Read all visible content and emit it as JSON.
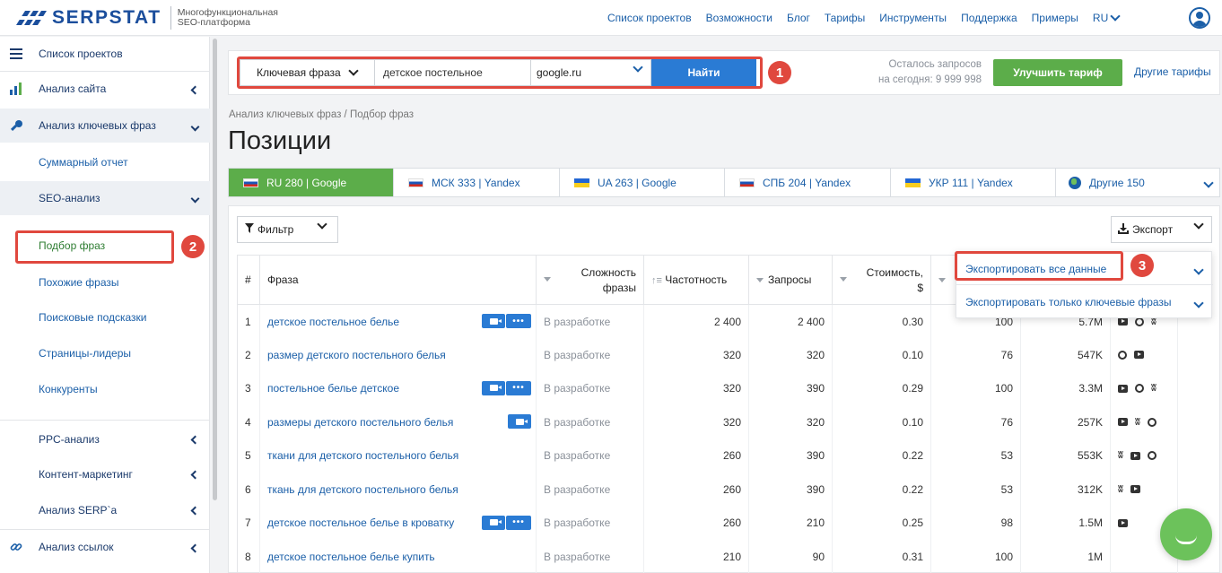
{
  "brand": {
    "name": "SERPSTAT",
    "tagline_line1": "Многофункциональная",
    "tagline_line2": "SEO-платформа"
  },
  "topnav": {
    "items": [
      "Список проектов",
      "Возможности",
      "Блог",
      "Тарифы",
      "Инструменты",
      "Поддержка",
      "Примеры"
    ],
    "language": "RU"
  },
  "sidebar": {
    "items": [
      {
        "label": "Список проектов",
        "icon": "menu-icon"
      },
      {
        "label": "Анализ сайта",
        "icon": "bar-chart-icon"
      },
      {
        "label": "Анализ ключевых фраз",
        "icon": "key-icon"
      },
      {
        "label": "Суммарный отчет"
      },
      {
        "label": "SEO-анализ"
      },
      {
        "label": "Подбор фраз"
      },
      {
        "label": "Похожие фразы"
      },
      {
        "label": "Поисковые подсказки"
      },
      {
        "label": "Страницы-лидеры"
      },
      {
        "label": "Конкуренты"
      },
      {
        "label": "PPC-анализ"
      },
      {
        "label": "Контент-маркетинг"
      },
      {
        "label": "Анализ SERP`а"
      },
      {
        "label": "Анализ ссылок",
        "icon": "link-icon"
      }
    ]
  },
  "search": {
    "type_label": "Ключевая фраза",
    "query": "детское постельное",
    "engine": "google.ru",
    "find_label": "Найти"
  },
  "account": {
    "remaining_line1": "Осталось запросов",
    "remaining_line2": "на сегодня: 9 999 998",
    "upgrade_label": "Улучшить тариф",
    "other_tariffs": "Другие тарифы"
  },
  "page": {
    "breadcrumb": "Анализ ключевых фраз / Подбор фраз",
    "title": "Позиции"
  },
  "tabs": [
    {
      "label": "RU 280 | Google",
      "flag": "ru",
      "active": true
    },
    {
      "label": "МСК 333 | Yandex",
      "flag": "ru"
    },
    {
      "label": "UA 263 | Google",
      "flag": "ua"
    },
    {
      "label": "СПБ 204 | Yandex",
      "flag": "ru"
    },
    {
      "label": "УКР 111 | Yandex",
      "flag": "ua"
    },
    {
      "label": "Другие 150",
      "flag": "globe"
    }
  ],
  "toolbar": {
    "filter_label": "Фильтр",
    "export_label": "Экспорт"
  },
  "export_menu": {
    "all_data": "Экспортировать все данные",
    "keywords_only": "Экспортировать только ключевые фразы"
  },
  "callouts": [
    "1",
    "2",
    "3"
  ],
  "table": {
    "headers": {
      "num": "#",
      "phrase": "Фраза",
      "difficulty_1": "Сложность",
      "difficulty_2": "фразы",
      "frequency": "Частотность",
      "queries": "Запросы",
      "cost_1": "Стоимость,",
      "cost_2": "$"
    },
    "rows": [
      {
        "n": "1",
        "phrase": "детское постельное белье",
        "difficulty": "В разработке",
        "freq": "2 400",
        "queries": "2 400",
        "cost": "0.30",
        "comp": "100",
        "results": "5.7M",
        "actions": "video-more",
        "social": [
          "youtube-icon",
          "pinterest-icon",
          "vk-icon"
        ]
      },
      {
        "n": "2",
        "phrase": "размер детского постельного белья",
        "difficulty": "В разработке",
        "freq": "320",
        "queries": "320",
        "cost": "0.10",
        "comp": "76",
        "results": "547K",
        "actions": "",
        "social": [
          "pinterest-icon",
          "youtube-icon"
        ]
      },
      {
        "n": "3",
        "phrase": "постельное белье детское",
        "difficulty": "В разработке",
        "freq": "320",
        "queries": "390",
        "cost": "0.29",
        "comp": "100",
        "results": "3.3M",
        "actions": "video-more",
        "social": [
          "youtube-icon",
          "pinterest-icon",
          "vk-icon"
        ]
      },
      {
        "n": "4",
        "phrase": "размеры детского постельного белья",
        "difficulty": "В разработке",
        "freq": "320",
        "queries": "320",
        "cost": "0.10",
        "comp": "76",
        "results": "257K",
        "actions": "video",
        "social": [
          "youtube-icon",
          "vk-icon",
          "pinterest-icon"
        ]
      },
      {
        "n": "5",
        "phrase": "ткани для детского постельного белья",
        "difficulty": "В разработке",
        "freq": "260",
        "queries": "390",
        "cost": "0.22",
        "comp": "53",
        "results": "553K",
        "actions": "",
        "social": [
          "vk-icon",
          "youtube-icon",
          "pinterest-icon"
        ]
      },
      {
        "n": "6",
        "phrase": "ткань для детского постельного белья",
        "difficulty": "В разработке",
        "freq": "260",
        "queries": "390",
        "cost": "0.22",
        "comp": "53",
        "results": "312K",
        "actions": "",
        "social": [
          "vk-icon",
          "youtube-icon"
        ]
      },
      {
        "n": "7",
        "phrase": "детское постельное белье в кроватку",
        "difficulty": "В разработке",
        "freq": "260",
        "queries": "210",
        "cost": "0.25",
        "comp": "98",
        "results": "1.5M",
        "actions": "video-more",
        "social": [
          "youtube-icon"
        ]
      },
      {
        "n": "8",
        "phrase": "детское постельное белье купить",
        "difficulty": "В разработке",
        "freq": "210",
        "queries": "90",
        "cost": "0.31",
        "comp": "100",
        "results": "1M",
        "actions": "",
        "social": []
      }
    ]
  },
  "colors": {
    "brand_blue": "#1b4e9c",
    "link_blue": "#1b5fa8",
    "button_blue": "#2a7bd4",
    "green": "#5cad4a",
    "highlight_red": "#e0483e"
  }
}
